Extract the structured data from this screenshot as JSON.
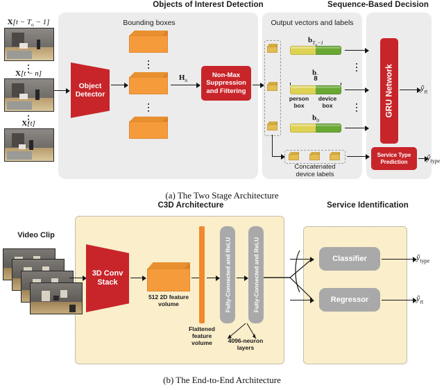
{
  "figure": {
    "panel_a": {
      "caption": "(a) The Two Stage Architecture",
      "section_headers": {
        "detection": "Objects of Interest Detection",
        "decision": "Sequence-Based Decision"
      },
      "input_labels": [
        "X[t − To − 1]",
        "X[t − n]",
        "X[t]"
      ],
      "input_label_parts": [
        {
          "base": "X",
          "bracket_open": "[",
          "body": "t − T",
          "sub": "o",
          "tail": " − 1",
          "bracket_close": "]"
        },
        {
          "base": "X",
          "bracket_open": "[",
          "body": "t − n",
          "sub": "",
          "tail": "",
          "bracket_close": "]"
        },
        {
          "base": "X",
          "bracket_open": "[",
          "body": "t",
          "sub": "",
          "tail": "",
          "bracket_close": "]"
        }
      ],
      "object_detector_label": "Object Detector",
      "object_detector_lines": [
        "Object",
        "Detector"
      ],
      "bounding_boxes_label": "Bounding boxes",
      "hidden_state_label": "H",
      "hidden_state_sub": "n",
      "nms_lines": [
        "Non-Max",
        "Suppression",
        "and Filtering"
      ],
      "output_vectors_label": "Output vectors and labels",
      "vector_labels": [
        {
          "base": "b",
          "sub": "To−1"
        },
        {
          "base": "b",
          "sub": "n"
        },
        {
          "base": "b",
          "sub": "0"
        }
      ],
      "dimension_label": "8",
      "segment_labels": [
        [
          "person",
          "box"
        ],
        [
          "device",
          "box"
        ]
      ],
      "concatenated_label_lines": [
        "Concatenated",
        "device labels"
      ],
      "gru_label": "GRU Network",
      "service_type_lines": [
        "Service Type",
        "Prediction"
      ],
      "outputs": [
        {
          "base": "ŷ",
          "sub": "rt"
        },
        {
          "base": "ŷ",
          "sub": "type"
        }
      ]
    },
    "panel_b": {
      "caption": "(b) The End-to-End Architecture",
      "section_headers": {
        "c3d": "C3D Architecture",
        "service": "Service Identification"
      },
      "video_clip_label": "Video Clip",
      "conv_stack_lines": [
        "3D Conv",
        "Stack"
      ],
      "feature_volume_lines": [
        "512 2D feature",
        "volume"
      ],
      "flattened_lines": [
        "Flattened",
        "feature",
        "volume"
      ],
      "fc_layer_label": "Fully-Connected and ReLU",
      "fc_note_lines": [
        "4096-neuron",
        "layers"
      ],
      "classifier_label": "Classifier",
      "regressor_label": "Regressor",
      "outputs": [
        {
          "base": "ŷ",
          "sub": "type"
        },
        {
          "base": "ŷ",
          "sub": "rt"
        }
      ]
    }
  },
  "colors": {
    "accent_red": "#C8252A",
    "orange_box": "#F59B3C",
    "gold_box": "#E3BD52",
    "vector_yellow": "#DED254",
    "vector_green": "#6AA833",
    "panel_grey": "#ECECEC",
    "panel_cream": "#FAEECB",
    "grey_block": "#A9A9A9",
    "flat_bar": "#F08A2E"
  }
}
